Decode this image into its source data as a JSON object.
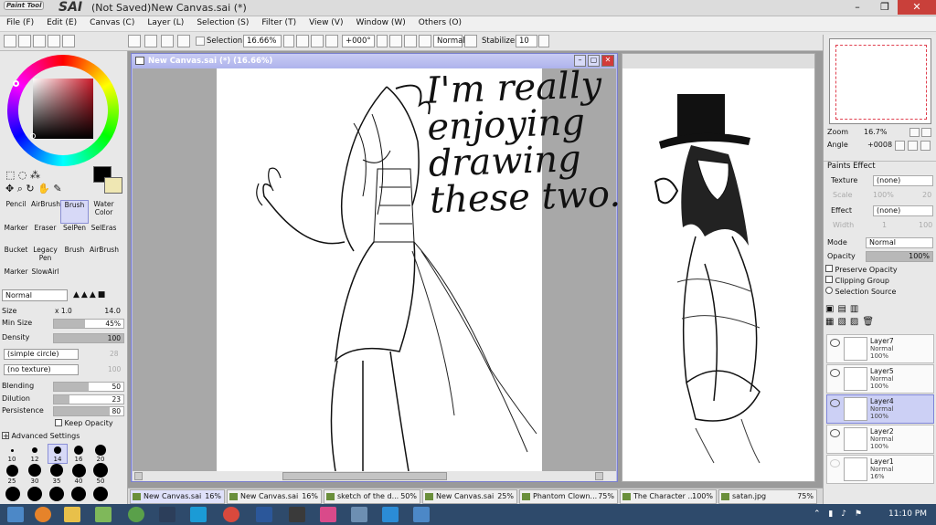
{
  "app": {
    "logo_small": "Paint Tool",
    "logo_big": "SAI",
    "window_title": "(Not Saved)New Canvas.sai (*)"
  },
  "menu": [
    "File (F)",
    "Edit (E)",
    "Canvas (C)",
    "Layer (L)",
    "Selection (S)",
    "Filter (T)",
    "View (V)",
    "Window (W)",
    "Others (O)"
  ],
  "toolbar": {
    "selection_label": "Selection",
    "zoom": "16.66%",
    "rotation": "+000°",
    "blend_mode": "Normal",
    "stabilizer_label": "Stabilizer",
    "stabilizer_value": "10"
  },
  "tools": [
    {
      "label": "Pencil"
    },
    {
      "label": "AirBrush"
    },
    {
      "label": "Brush",
      "selected": true
    },
    {
      "label": "Water Color"
    },
    {
      "label": "Marker"
    },
    {
      "label": "Eraser"
    },
    {
      "label": "SelPen"
    },
    {
      "label": "SelEras"
    },
    {
      "label": "Bucket"
    },
    {
      "label": "Legacy Pen"
    },
    {
      "label": "Brush"
    },
    {
      "label": "AirBrush"
    },
    {
      "label": "Marker"
    },
    {
      "label": "SlowAirl"
    }
  ],
  "brush": {
    "mode": "Normal",
    "size_label": "Size",
    "size_mult": "x 1.0",
    "size_value": "14.0",
    "min_size_label": "Min Size",
    "min_size_value": "45%",
    "min_size_fill": 0.45,
    "density_label": "Density",
    "density_value": "100",
    "density_fill": 1.0,
    "shape": "(simple circle)",
    "shape_value": "28",
    "texture": "(no texture)",
    "texture_value": "100",
    "blending_label": "Blending",
    "blending_value": "50",
    "blending_fill": 0.5,
    "dilution_label": "Dilution",
    "dilution_value": "23",
    "dilution_fill": 0.23,
    "persistence_label": "Persistence",
    "persistence_value": "80",
    "persistence_fill": 0.8,
    "keep_opacity_label": "Keep Opacity",
    "advanced_label": "Advanced Settings",
    "dot_sizes_row1": [
      "10",
      "12",
      "14",
      "16",
      "20"
    ],
    "dot_sizes_row2": [
      "25",
      "30",
      "35",
      "40",
      "50"
    ]
  },
  "canvas": {
    "title": "New Canvas.sai (*) (16.66%)",
    "handwriting": "I'm really enjoying drawing these two."
  },
  "navigator": {
    "zoom_label": "Zoom",
    "zoom_value": "16.7%",
    "angle_label": "Angle",
    "angle_value": "+0008"
  },
  "paints_effect": {
    "header": "Paints Effect",
    "texture_label": "Texture",
    "texture_value": "(none)",
    "scale_label": "Scale",
    "scale_value": "100%",
    "scale_num": "20",
    "effect_label": "Effect",
    "effect_value": "(none)",
    "width_label": "Width",
    "width_value": "1",
    "width_num": "100"
  },
  "layer_props": {
    "mode_label": "Mode",
    "mode_value": "Normal",
    "opacity_label": "Opacity",
    "opacity_value": "100%",
    "preserve_opacity": "Preserve Opacity",
    "clipping_group": "Clipping Group",
    "selection_source": "Selection Source"
  },
  "layers": [
    {
      "name": "Layer7",
      "mode": "Normal",
      "opacity": "100%",
      "visible": true,
      "selected": false
    },
    {
      "name": "Layer5",
      "mode": "Normal",
      "opacity": "100%",
      "visible": true,
      "selected": false
    },
    {
      "name": "Layer4",
      "mode": "Normal",
      "opacity": "100%",
      "visible": true,
      "selected": true
    },
    {
      "name": "Layer2",
      "mode": "Normal",
      "opacity": "100%",
      "visible": true,
      "selected": false
    },
    {
      "name": "Layer1",
      "mode": "Normal",
      "opacity": "16%",
      "visible": false,
      "selected": false
    }
  ],
  "doc_tabs": [
    {
      "name": "New Canvas.sai",
      "pct": "16%",
      "active": true
    },
    {
      "name": "New Canvas.sai",
      "pct": "16%",
      "active": false
    },
    {
      "name": "sketch of the d...",
      "pct": "50%",
      "active": false
    },
    {
      "name": "New Canvas.sai",
      "pct": "25%",
      "active": false
    },
    {
      "name": "Phantom Clown...",
      "pct": "75%",
      "active": false
    },
    {
      "name": "The Character ...",
      "pct": "100%",
      "active": false
    },
    {
      "name": "satan.jpg",
      "pct": "75%",
      "active": false
    }
  ],
  "taskbar": {
    "clock": "11:10 PM"
  }
}
